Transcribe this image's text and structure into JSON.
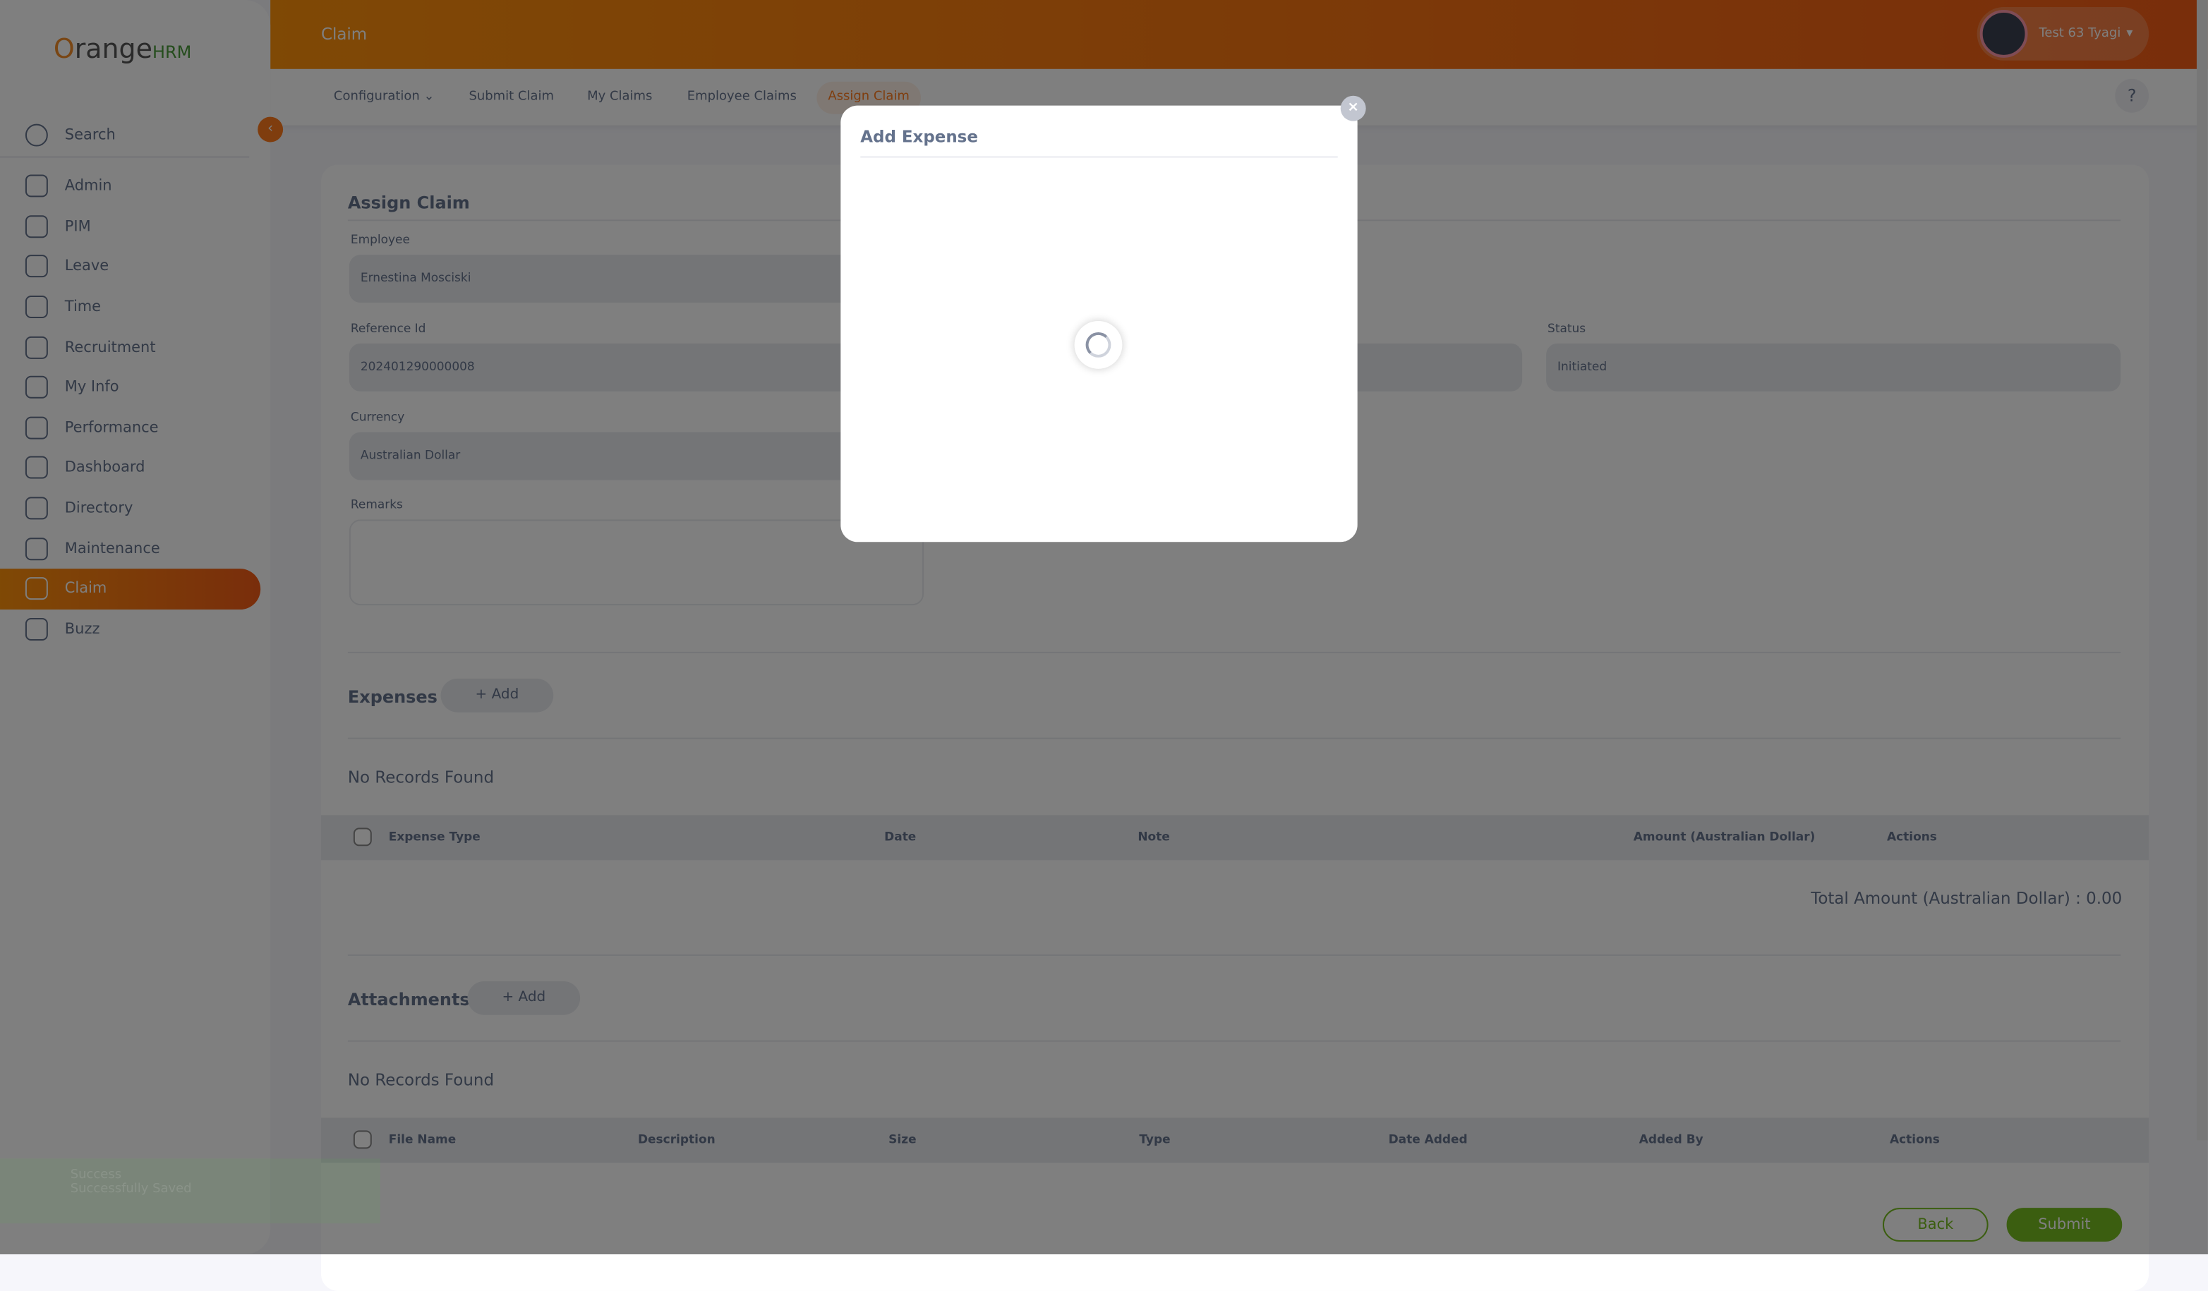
{
  "brand": {
    "logo": "OrangeHRM"
  },
  "sidebar": {
    "search": "Search",
    "items": [
      {
        "label": "Admin"
      },
      {
        "label": "PIM"
      },
      {
        "label": "Leave"
      },
      {
        "label": "Time"
      },
      {
        "label": "Recruitment"
      },
      {
        "label": "My Info"
      },
      {
        "label": "Performance"
      },
      {
        "label": "Dashboard"
      },
      {
        "label": "Directory"
      },
      {
        "label": "Maintenance"
      },
      {
        "label": "Claim",
        "active": true
      },
      {
        "label": "Buzz"
      }
    ]
  },
  "header": {
    "title": "Claim",
    "user": "Test 63 Tyagi",
    "help": "?"
  },
  "tabs": {
    "configuration": "Configuration",
    "submit": "Submit Claim",
    "my": "My Claims",
    "employee": "Employee Claims",
    "assign": "Assign Claim"
  },
  "form": {
    "title": "Assign Claim",
    "employee_label": "Employee",
    "employee": "Ernestina Mosciski",
    "ref_label": "Reference Id",
    "ref": "202401290000008",
    "status_label": "Status",
    "status": "Initiated",
    "currency_label": "Currency",
    "currency": "Australian Dollar",
    "remarks_label": "Remarks"
  },
  "expenses": {
    "title": "Expenses",
    "add": "+ Add",
    "empty": "No Records Found",
    "columns": [
      "Expense Type",
      "Date",
      "Note",
      "Amount (Australian Dollar)",
      "Actions"
    ],
    "total": "Total Amount (Australian Dollar) : 0.00"
  },
  "attachments": {
    "title": "Attachments",
    "add": "+ Add",
    "empty": "No Records Found",
    "columns": [
      "File Name",
      "Description",
      "Size",
      "Type",
      "Date Added",
      "Added By",
      "Actions"
    ]
  },
  "buttons": {
    "back": "Back",
    "submit": "Submit"
  },
  "toast": {
    "title": "Success",
    "message": "Successfully Saved"
  },
  "modal": {
    "title": "Add Expense",
    "close": "×"
  }
}
